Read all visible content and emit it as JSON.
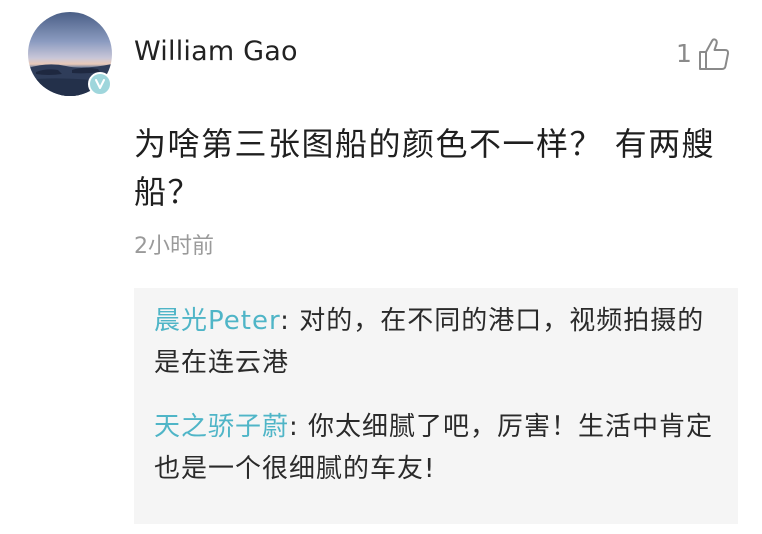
{
  "comment": {
    "username": "William Gao",
    "like_count": "1",
    "body": "为啥第三张图船的颜色不一样？ 有两艘船？",
    "timestamp": "2小时前",
    "icons": {
      "avatar": "avatar-landscape-photo",
      "verified": "verified-v-icon",
      "like": "thumbs-up-icon"
    }
  },
  "replies": [
    {
      "author": "晨光Peter",
      "separator": ": ",
      "text": "对的，在不同的港口，视频拍摄的是在连云港"
    },
    {
      "author": "天之骄子蔚",
      "separator": ": ",
      "text": "你太细腻了吧，厉害！生活中肯定也是一个很细腻的车友!"
    }
  ],
  "colors": {
    "author_accent": "#4fb5c7",
    "badge": "#9fd6dc",
    "reply_background": "#f5f5f5",
    "muted_text": "#9a9a9a"
  }
}
